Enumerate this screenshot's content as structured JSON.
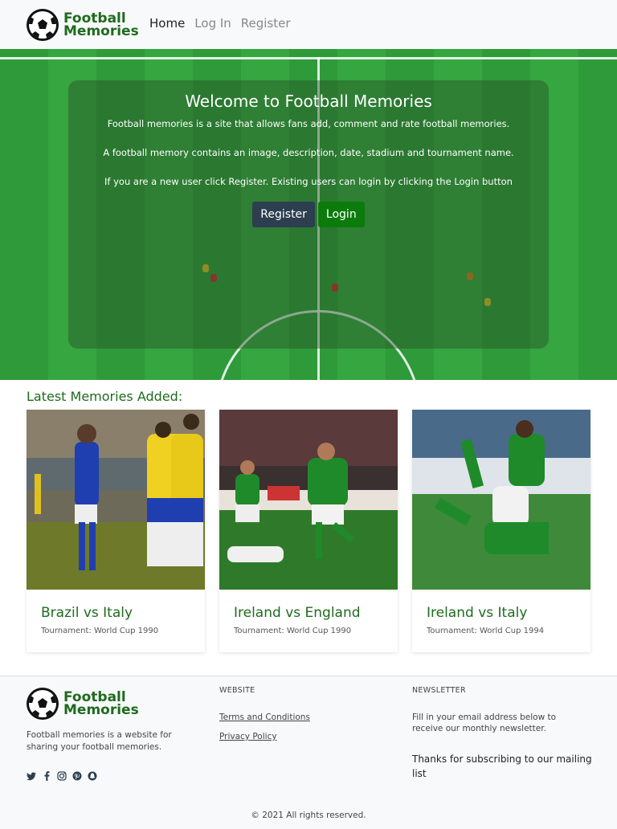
{
  "nav": {
    "logo_line1": "Football",
    "logo_line2": "Memories",
    "links": [
      {
        "label": "Home",
        "active": true
      },
      {
        "label": "Log In",
        "active": false
      },
      {
        "label": "Register",
        "active": false
      }
    ]
  },
  "hero": {
    "title": "Welcome to Football Memories",
    "line1": "Football memories is a site that allows fans add, comment and rate football memories.",
    "line2": "A football memory contains an image, description, date, stadium and tournament name.",
    "line3": "If you are a new user click Register. Existing users can login by clicking the Login button",
    "register_label": "Register",
    "login_label": "Login"
  },
  "latest": {
    "heading": "Latest Memories Added:",
    "cards": [
      {
        "title": "Brazil vs Italy",
        "tournament": "Tournament: World Cup 1990"
      },
      {
        "title": "Ireland vs England",
        "tournament": "Tournament: World Cup 1990"
      },
      {
        "title": "Ireland vs Italy",
        "tournament": "Tournament: World Cup 1994"
      }
    ]
  },
  "footer": {
    "logo_line1": "Football",
    "logo_line2": "Memories",
    "description": "Football memories is a website for sharing your football memories.",
    "socials": [
      "twitter-icon",
      "facebook-icon",
      "instagram-icon",
      "pinterest-icon",
      "snapchat-icon"
    ],
    "website_heading": "WEBSITE",
    "links": [
      "Terms and Conditions",
      "Privacy Policy"
    ],
    "newsletter_heading": "NEWSLETTER",
    "newsletter_text": "Fill in your email address below to receive our monthly newsletter.",
    "thanks_text": "Thanks for subscribing to our mailing list",
    "copyright": "© 2021 All rights reserved."
  },
  "colors": {
    "brand_green": "#1e6b1e",
    "login_button": "#0b7b0b",
    "register_button": "#2c3e50"
  }
}
